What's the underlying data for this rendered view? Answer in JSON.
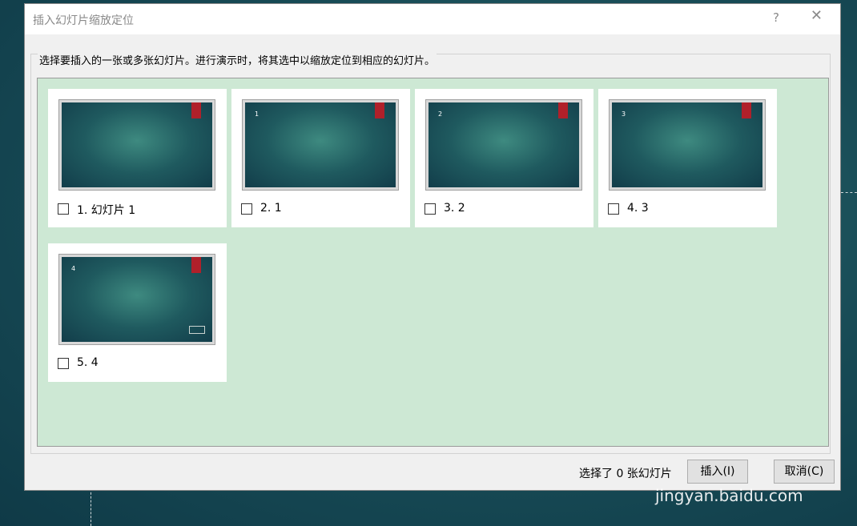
{
  "dialog": {
    "title": "插入幻灯片缩放定位",
    "help": "?",
    "close": "✕",
    "instruction": "选择要插入的一张或多张幻灯片。进行演示时，将其选中以缩放定位到相应的幻灯片。"
  },
  "slides": [
    {
      "label": "1. 幻灯片 1",
      "thumb_number": "",
      "checked": false
    },
    {
      "label": "2. 1",
      "thumb_number": "1",
      "checked": false
    },
    {
      "label": "3. 2",
      "thumb_number": "2",
      "checked": false
    },
    {
      "label": "4. 3",
      "thumb_number": "3",
      "checked": false
    },
    {
      "label": "5. 4",
      "thumb_number": "4",
      "checked": false
    }
  ],
  "footer": {
    "status": "选择了 0 张幻灯片",
    "insert_label": "插入(I)",
    "cancel_label": "取消(C)"
  },
  "watermark": "jingyan.baidu.com"
}
